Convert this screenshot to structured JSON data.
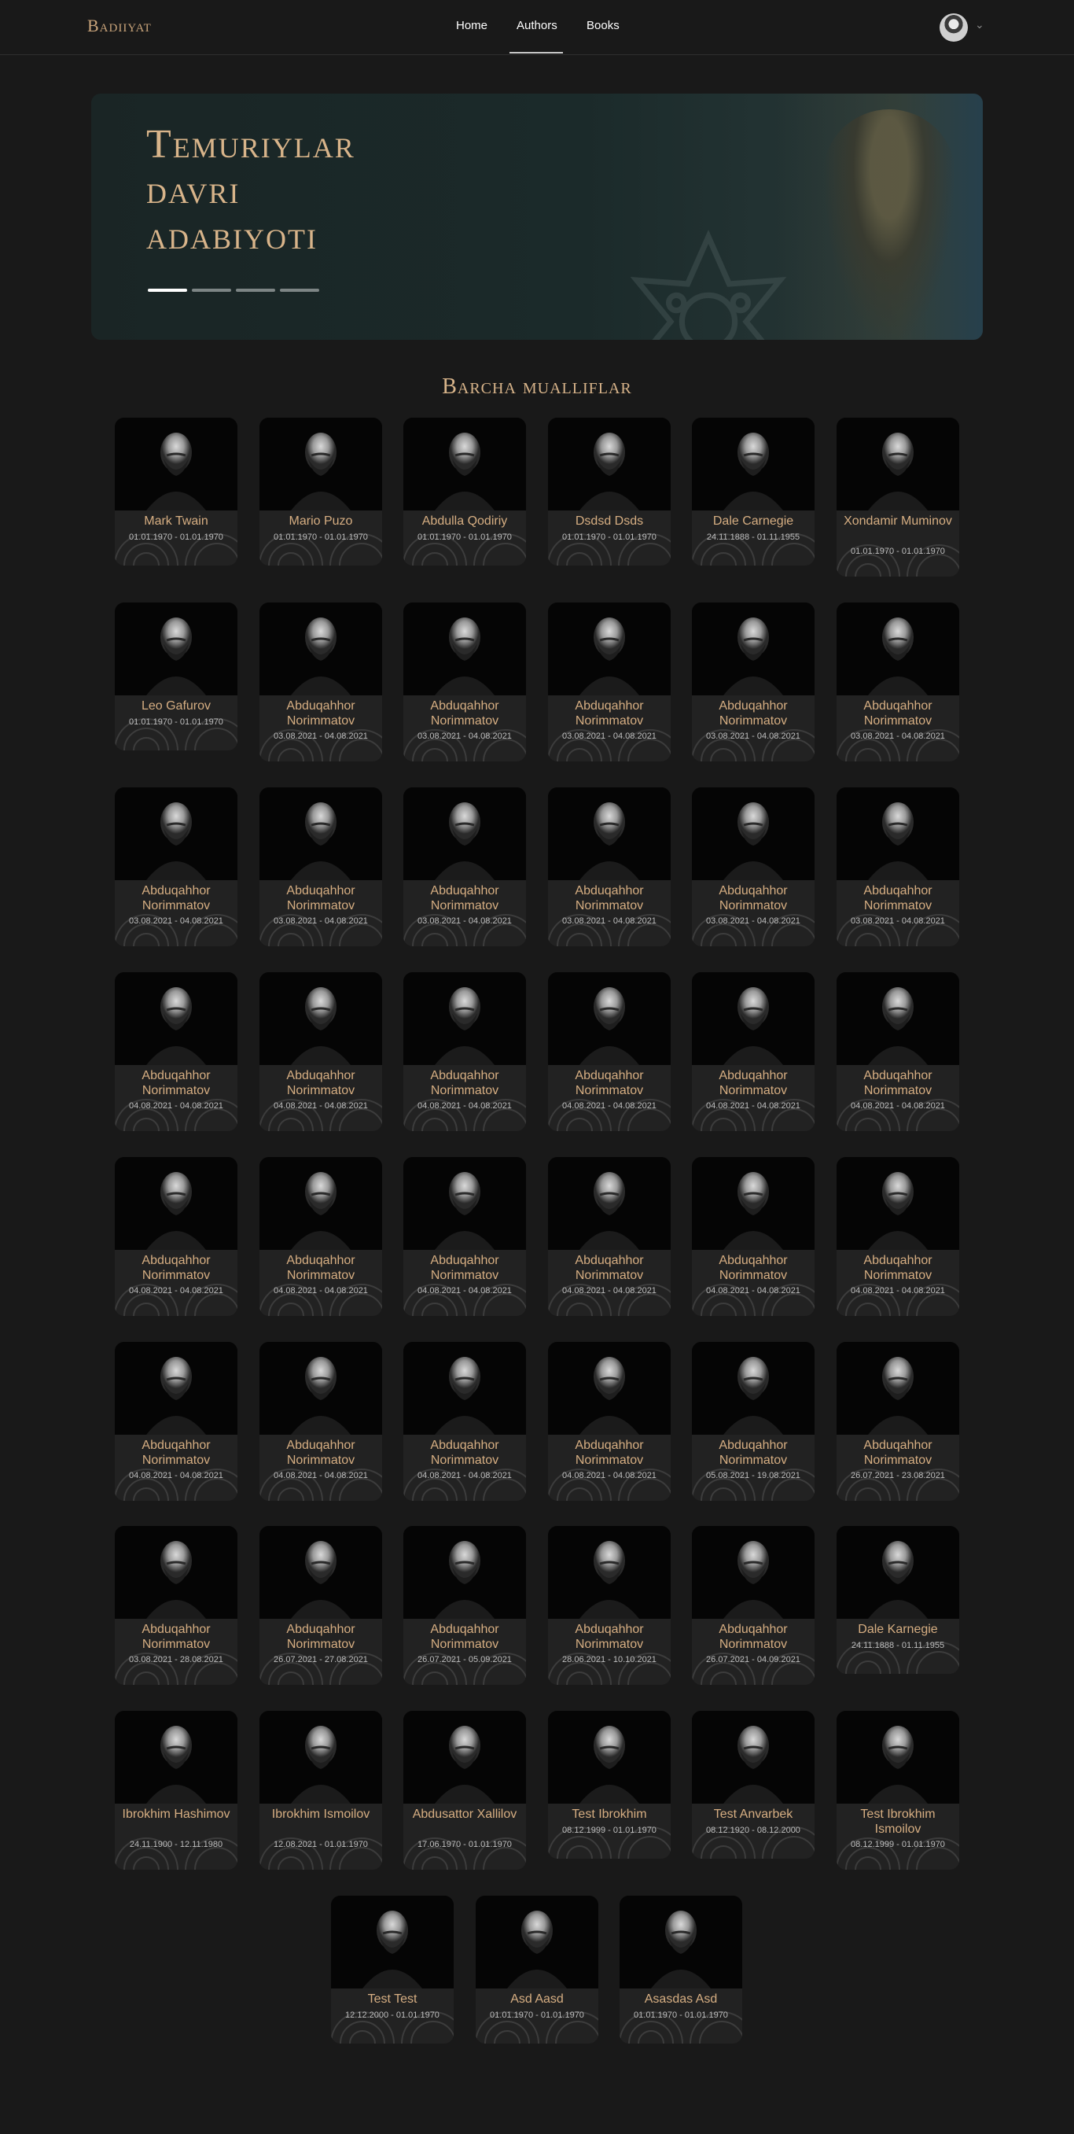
{
  "header": {
    "logo": "Badiiyat",
    "nav": [
      {
        "label": "Home"
      },
      {
        "label": "Authors"
      },
      {
        "label": "Books"
      }
    ],
    "active_nav": "Authors",
    "avatar_icon": "user-avatar-icon",
    "dropdown_icon": "chevron-down-icon"
  },
  "hero": {
    "title_lines": [
      "Temuriylar",
      "davri",
      "adabiyoti"
    ],
    "slides_count": 4,
    "active_slide": 1
  },
  "section": {
    "title": "Barcha mualliflar"
  },
  "authors": [
    {
      "name": "Mark Twain",
      "dates": "01.01.1970 - 01.01.1970"
    },
    {
      "name": "Mario Puzo",
      "dates": "01.01.1970 - 01.01.1970"
    },
    {
      "name": "Abdulla Qodiriy",
      "dates": "01.01.1970 - 01.01.1970"
    },
    {
      "name": "Dsdsd Dsds",
      "dates": "01.01.1970 - 01.01.1970"
    },
    {
      "name": "Dale Carnegie",
      "dates": "24.11.1888 - 01.11.1955"
    },
    {
      "name": "Xondamir Muminov",
      "dates": "01.01.1970 - 01.01.1970"
    },
    {
      "name": "Leo Gafurov",
      "dates": "01.01.1970 - 01.01.1970"
    },
    {
      "name": "Abduqahhor Norimmatov",
      "dates": "03.08.2021 - 04.08.2021"
    },
    {
      "name": "Abduqahhor Norimmatov",
      "dates": "03.08.2021 - 04.08.2021"
    },
    {
      "name": "Abduqahhor Norimmatov",
      "dates": "03.08.2021 - 04.08.2021"
    },
    {
      "name": "Abduqahhor Norimmatov",
      "dates": "03.08.2021 - 04.08.2021"
    },
    {
      "name": "Abduqahhor Norimmatov",
      "dates": "03.08.2021 - 04.08.2021"
    },
    {
      "name": "Abduqahhor Norimmatov",
      "dates": "03.08.2021 - 04.08.2021"
    },
    {
      "name": "Abduqahhor Norimmatov",
      "dates": "03.08.2021 - 04.08.2021"
    },
    {
      "name": "Abduqahhor Norimmatov",
      "dates": "03.08.2021 - 04.08.2021"
    },
    {
      "name": "Abduqahhor Norimmatov",
      "dates": "03.08.2021 - 04.08.2021"
    },
    {
      "name": "Abduqahhor Norimmatov",
      "dates": "03.08.2021 - 04.08.2021"
    },
    {
      "name": "Abduqahhor Norimmatov",
      "dates": "03.08.2021 - 04.08.2021"
    },
    {
      "name": "Abduqahhor Norimmatov",
      "dates": "04.08.2021 - 04.08.2021"
    },
    {
      "name": "Abduqahhor Norimmatov",
      "dates": "04.08.2021 - 04.08.2021"
    },
    {
      "name": "Abduqahhor Norimmatov",
      "dates": "04.08.2021 - 04.08.2021"
    },
    {
      "name": "Abduqahhor Norimmatov",
      "dates": "04.08.2021 - 04.08.2021"
    },
    {
      "name": "Abduqahhor Norimmatov",
      "dates": "04.08.2021 - 04.08.2021"
    },
    {
      "name": "Abduqahhor Norimmatov",
      "dates": "04.08.2021 - 04.08.2021"
    },
    {
      "name": "Abduqahhor Norimmatov",
      "dates": "04.08.2021 - 04.08.2021"
    },
    {
      "name": "Abduqahhor Norimmatov",
      "dates": "04.08.2021 - 04.08.2021"
    },
    {
      "name": "Abduqahhor Norimmatov",
      "dates": "04.08.2021 - 04.08.2021"
    },
    {
      "name": "Abduqahhor Norimmatov",
      "dates": "04.08.2021 - 04.08.2021"
    },
    {
      "name": "Abduqahhor Norimmatov",
      "dates": "04.08.2021 - 04.08.2021"
    },
    {
      "name": "Abduqahhor Norimmatov",
      "dates": "04.08.2021 - 04.08.2021"
    },
    {
      "name": "Abduqahhor Norimmatov",
      "dates": "04.08.2021 - 04.08.2021"
    },
    {
      "name": "Abduqahhor Norimmatov",
      "dates": "04.08.2021 - 04.08.2021"
    },
    {
      "name": "Abduqahhor Norimmatov",
      "dates": "04.08.2021 - 04.08.2021"
    },
    {
      "name": "Abduqahhor Norimmatov",
      "dates": "04.08.2021 - 04.08.2021"
    },
    {
      "name": "Abduqahhor Norimmatov",
      "dates": "05.08.2021 - 19.08.2021"
    },
    {
      "name": "Abduqahhor Norimmatov",
      "dates": "26.07.2021 - 23.08.2021"
    },
    {
      "name": "Abduqahhor Norimmatov",
      "dates": "03.08.2021 - 28.08.2021"
    },
    {
      "name": "Abduqahhor Norimmatov",
      "dates": "26.07.2021 - 27.08.2021"
    },
    {
      "name": "Abduqahhor Norimmatov",
      "dates": "26.07.2021 - 05.09.2021"
    },
    {
      "name": "Abduqahhor Norimmatov",
      "dates": "28.06.2021 - 10.10.2021"
    },
    {
      "name": "Abduqahhor Norimmatov",
      "dates": "26.07.2021 - 04.09.2021"
    },
    {
      "name": "Dale Karnegie",
      "dates": "24.11.1888 - 01.11.1955"
    },
    {
      "name": "Ibrokhim Hashimov",
      "dates": "24.11.1900 - 12.11.1980"
    },
    {
      "name": "Ibrokhim Ismoilov",
      "dates": "12.08.2021 - 01.01.1970"
    },
    {
      "name": "Abdusattor Xallilov",
      "dates": "17.06.1970 - 01.01.1970"
    },
    {
      "name": "Test Ibrokhim",
      "dates": "08.12.1999 - 01.01.1970"
    },
    {
      "name": "Test Anvarbek",
      "dates": "08.12.1920 - 08.12.2000"
    },
    {
      "name": "Test Ibrokhim Ismoilov",
      "dates": "08.12.1999 - 01.01.1970"
    },
    {
      "name": "Test Test",
      "dates": "12.12.2000 - 01.01.1970"
    },
    {
      "name": "Asd Aasd",
      "dates": "01.01.1970 - 01.01.1970"
    },
    {
      "name": "Asasdas Asd",
      "dates": "01.01.1970 - 01.01.1970"
    }
  ]
}
